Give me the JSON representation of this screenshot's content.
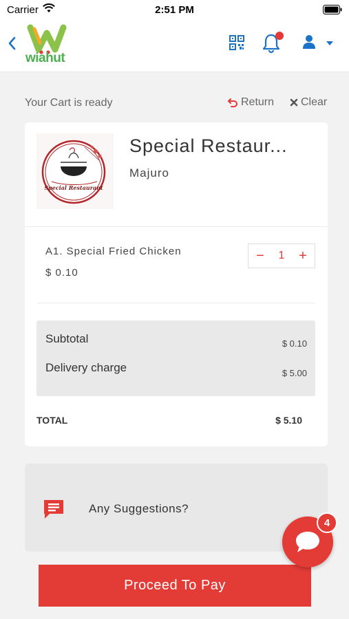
{
  "status": {
    "carrier": "Carrier",
    "time": "2:51 PM"
  },
  "header": {
    "logo_text": "wiahut",
    "icons": [
      "back-icon",
      "qr-code-icon",
      "bell-icon",
      "user-icon",
      "caret-down-icon"
    ],
    "accent_color": "#1a73c9"
  },
  "cart": {
    "ready_text": "Your Cart is ready",
    "return_label": "Return",
    "clear_label": "Clear"
  },
  "restaurant": {
    "name": "Special Restaur...",
    "city": "Majuro",
    "logo_text": "Special Restaurant"
  },
  "items": [
    {
      "name": "A1. Special Fried Chicken",
      "price": "$ 0.10",
      "quantity": "1"
    }
  ],
  "summary": {
    "subtotal_label": "Subtotal",
    "subtotal_value": "$ 0.10",
    "delivery_label": "Delivery charge",
    "delivery_value": "$ 5.00",
    "total_label": "TOTAL",
    "total_value": "$ 5.10"
  },
  "suggestions": {
    "label": "Any Suggestions?"
  },
  "actions": {
    "proceed_label": "Proceed To Pay"
  },
  "chat": {
    "badge_count": "4"
  },
  "colors": {
    "brand_red": "#e33b36",
    "logo_green": "#4caf50",
    "nav_blue": "#1a73c9"
  }
}
